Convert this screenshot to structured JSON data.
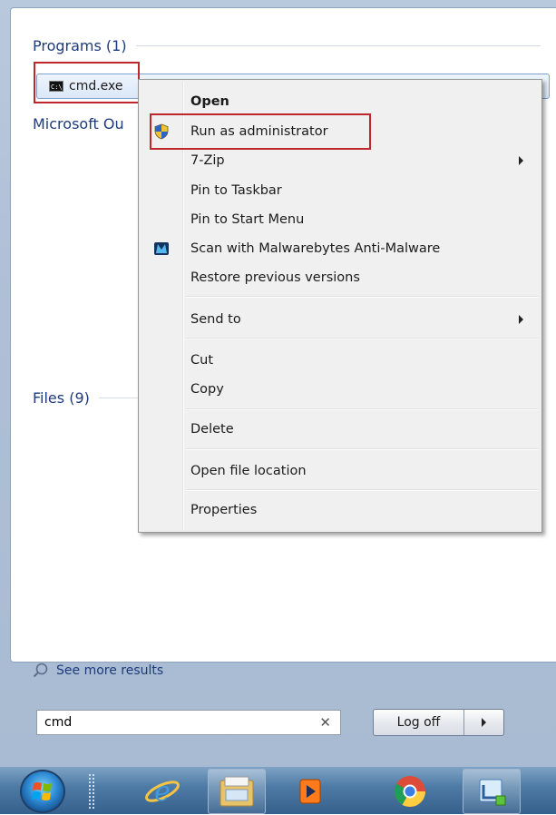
{
  "programs": {
    "header": "Programs (1)",
    "items": [
      {
        "label": "cmd.exe",
        "icon": "cmd-icon"
      }
    ]
  },
  "microsoft_outlook": {
    "label": "Microsoft Ou"
  },
  "files": {
    "header": "Files (9)"
  },
  "context_menu": {
    "open": "Open",
    "run_as_admin": "Run as administrator",
    "seven_zip": "7-Zip",
    "pin_taskbar": "Pin to Taskbar",
    "pin_start": "Pin to Start Menu",
    "malwarebytes": "Scan with Malwarebytes Anti-Malware",
    "restore": "Restore previous versions",
    "send_to": "Send to",
    "cut": "Cut",
    "copy": "Copy",
    "delete": "Delete",
    "open_location": "Open file location",
    "properties": "Properties"
  },
  "see_more": "See more results",
  "search": {
    "value": "cmd",
    "clear_icon": "close-icon"
  },
  "log_off": "Log off",
  "taskbar": {
    "items": [
      "start-orb-icon",
      "internet-explorer-icon",
      "file-explorer-icon",
      "media-player-icon",
      "chrome-icon",
      "remote-desktop-icon"
    ]
  },
  "colors": {
    "highlight": "#c0272d",
    "link": "#1e3b7a"
  }
}
